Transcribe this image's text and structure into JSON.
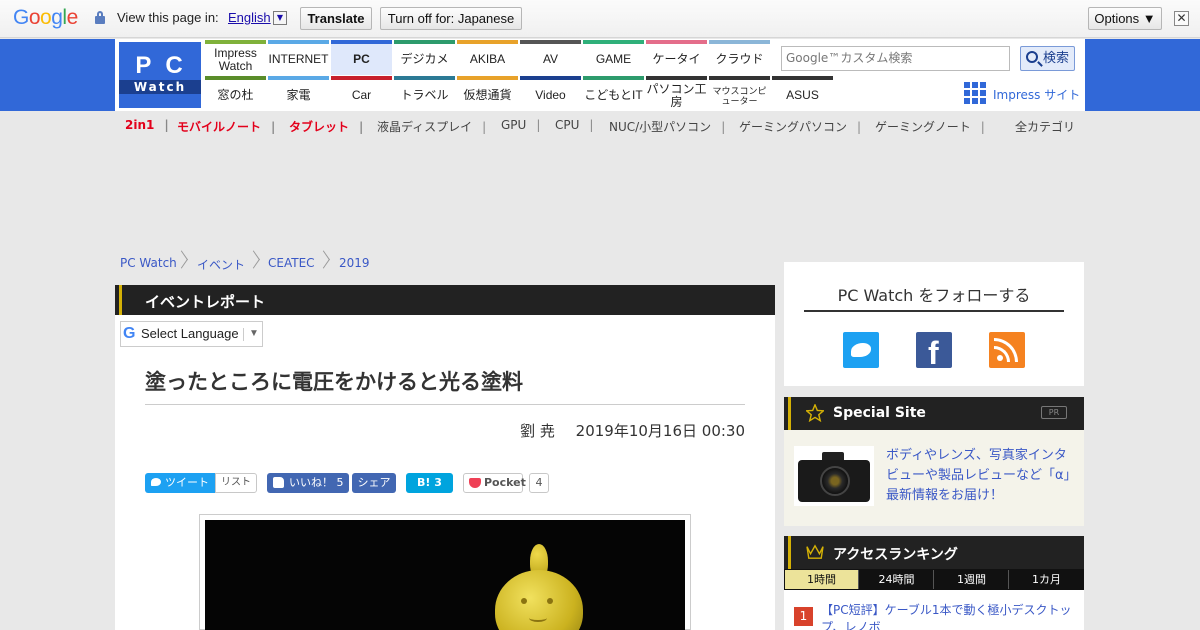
{
  "translate_bar": {
    "logo": "Google",
    "view_text": "View this page in:",
    "language": "English",
    "translate_label": "Translate",
    "turn_off_label": "Turn off for: Japanese",
    "options_label": "Options ▼",
    "close_label": "✕"
  },
  "logo": {
    "top": "PC",
    "bottom": "Watch"
  },
  "nav_top": [
    {
      "label": "Impress Watch",
      "color": "#7fb13a"
    },
    {
      "label": "INTERNET",
      "color": "#5aa9e6"
    },
    {
      "label": "PC",
      "color": "#3168d8"
    },
    {
      "label": "デジカメ",
      "color": "#2d9b6c"
    },
    {
      "label": "AKIBA",
      "color": "#e8a22a"
    },
    {
      "label": "AV",
      "color": "#555555"
    },
    {
      "label": "GAME",
      "color": "#2fb07a"
    },
    {
      "label": "ケータイ",
      "color": "#e46d8a"
    },
    {
      "label": "クラウド",
      "color": "#8bb6d8"
    }
  ],
  "nav_bottom": [
    {
      "label": "窓の杜",
      "color": "#5a8d2a"
    },
    {
      "label": "家電",
      "color": "#5aa9e6"
    },
    {
      "label": "Car",
      "color": "#c8202c"
    },
    {
      "label": "トラベル",
      "color": "#2b7a95"
    },
    {
      "label": "仮想通貨",
      "color": "#e8a22a"
    },
    {
      "label": "Video",
      "color": "#1b3f8f"
    },
    {
      "label": "こどもとIT",
      "color": "#2d9b6c"
    },
    {
      "label": "パソコン工房",
      "color": "#333333"
    },
    {
      "label": "マウスコンピューター",
      "color": "#333333"
    },
    {
      "label": "ASUS",
      "color": "#333333"
    }
  ],
  "search": {
    "placeholder": "Google™カスタム検索",
    "button": "検索"
  },
  "impress_site": "Impress サイト",
  "categories": [
    {
      "label": "2in1",
      "highlight": true
    },
    {
      "label": "モバイルノート",
      "highlight": true
    },
    {
      "label": "タブレット",
      "highlight": true
    },
    {
      "label": "液晶ディスプレイ",
      "highlight": false
    },
    {
      "label": "GPU",
      "highlight": false
    },
    {
      "label": "CPU",
      "highlight": false
    },
    {
      "label": "NUC/小型パソコン",
      "highlight": false
    },
    {
      "label": "ゲーミングパソコン",
      "highlight": false
    },
    {
      "label": "ゲーミングノート",
      "highlight": false
    }
  ],
  "all_categories": "全カテゴリ",
  "breadcrumb": [
    "PC Watch",
    "イベント",
    "CEATEC",
    "2019"
  ],
  "section_title": "イベントレポート",
  "select_language": "Select Language",
  "article": {
    "title": "塗ったところに電圧をかけると光る塗料",
    "author": "劉 尭",
    "date": "2019年10月16日 00:30"
  },
  "share": {
    "tweet": "ツイート",
    "list": "リスト",
    "like": "いいね！ 5",
    "fb_share": "シェア",
    "hatena": "B! 3",
    "pocket": "Pocket",
    "pocket_count": "4"
  },
  "sidebar": {
    "follow_title": "PC Watch をフォローする",
    "special_title": "Special Site",
    "pr": "PR",
    "special_text": "ボディやレンズ、写真家インタビューや製品レビューなど「α」最新情報をお届け！",
    "ranking_title": "アクセスランキング",
    "ranking_tabs": [
      "1時間",
      "24時間",
      "1週間",
      "1カ月"
    ],
    "ranking_first_num": "1",
    "ranking_first_text": "【PC短評】ケーブル1本で動く極小デスクトップ、レノボ"
  }
}
